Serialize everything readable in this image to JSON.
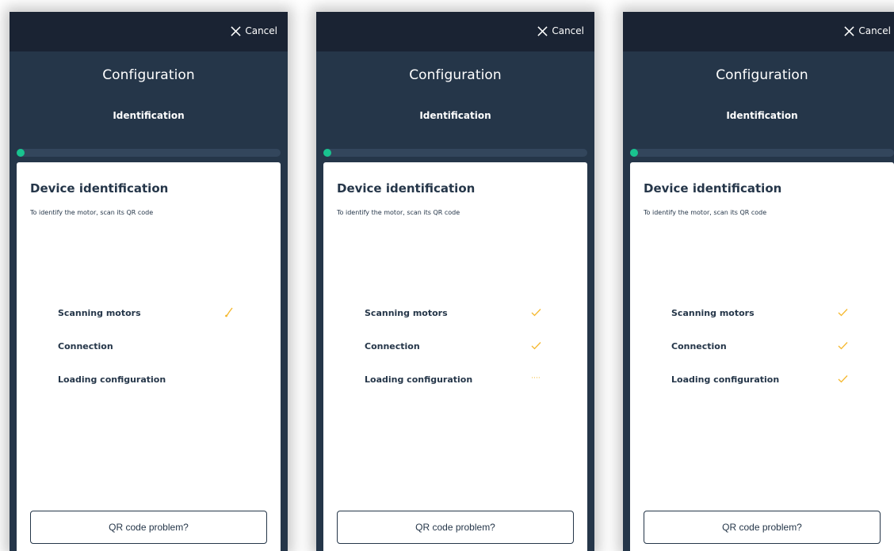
{
  "cancel_label": "Cancel",
  "title": "Configuration",
  "subtitle": "Identification",
  "card": {
    "title": "Device identification",
    "description": "To identify the motor, scan its QR code",
    "qr_button": "QR code problem?"
  },
  "colors": {
    "accent": "#f5b82e",
    "progress": "#19c38f",
    "header": "#1a2333",
    "background": "#253649"
  },
  "screens": [
    {
      "progress_percent": 3,
      "steps": [
        {
          "label": "Scanning motors",
          "status": "in-progress"
        },
        {
          "label": "Connection",
          "status": "pending"
        },
        {
          "label": "Loading configuration",
          "status": "pending"
        }
      ]
    },
    {
      "progress_percent": 3,
      "steps": [
        {
          "label": "Scanning motors",
          "status": "done"
        },
        {
          "label": "Connection",
          "status": "done"
        },
        {
          "label": "Loading configuration",
          "status": "loading"
        }
      ]
    },
    {
      "progress_percent": 3,
      "steps": [
        {
          "label": "Scanning motors",
          "status": "done"
        },
        {
          "label": "Connection",
          "status": "done"
        },
        {
          "label": "Loading configuration",
          "status": "done"
        }
      ]
    }
  ]
}
